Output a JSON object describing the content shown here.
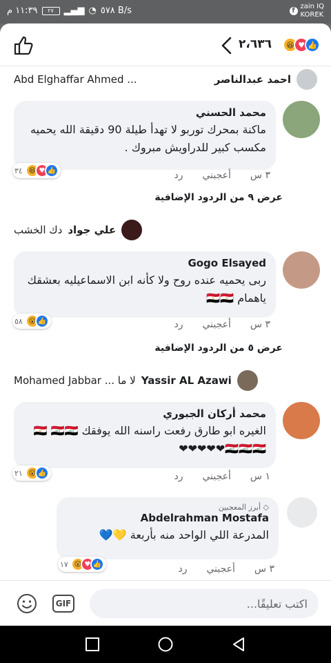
{
  "status": {
    "carrier": "zain IQ",
    "carrier2": "KOREK",
    "time": "١١:٣٩ م",
    "battery": "٢٧",
    "speed": "٥٧٨ B/s"
  },
  "header": {
    "reaction_count": "٢،٦٣٦"
  },
  "reply_preview_1": {
    "name": "احمد عبدالناصر",
    "text": "Abd Elghaffar Ahmed ..."
  },
  "comments": [
    {
      "name": "محمد الحسني",
      "text": "ماكنة بمحرك توربو لا تهدأ طيلة 90 دقيقة الله يحميه مكسب كبير للدراويش مبروك .",
      "time": "٣ س",
      "like": "أعجبني",
      "reply": "رد",
      "reaction_count": "٣٤",
      "more_replies": "عرض ٩ من الردود الإضافية"
    },
    {
      "name": "Gogo Elsayed",
      "text": "ربى يحميه عنده روح ولا كأنه ابن الاسماعيليه بعشقك ياهمام 🇪🇬🇪🇬",
      "time": "٣ س",
      "like": "أعجبني",
      "reply": "رد",
      "reaction_count": "٥٨",
      "more_replies": "عرض ٥ من الردود الإضافية"
    },
    {
      "name": "محمد أركان الجبوري",
      "text": "الغيره ابو طارق رفعت راسنه الله يوفقك 🇪🇬 🇮🇶🇮🇶🇮🇶🇮🇶🇮🇶❤❤❤❤❤",
      "time": "١ س",
      "like": "أعجبني",
      "reply": "رد",
      "reaction_count": "٢١"
    },
    {
      "badge": "أبرز المعجبين",
      "name": "Abdelrahman Mostafa",
      "text": "المدرعة اللي الواحد منه بأربعة 💛💙",
      "time": "٣ س",
      "like": "أعجبني",
      "reply": "رد",
      "reaction_count": "١٧"
    }
  ],
  "reply_preview_2": {
    "name": "علي جواد",
    "text": "دك الخشب"
  },
  "reply_preview_3": {
    "name": "Yassir AL Azawi",
    "text": "لا ما ... Mohamed Jabbar"
  },
  "composer": {
    "placeholder": "اكتب تعليقًا...",
    "gif": "GIF"
  }
}
